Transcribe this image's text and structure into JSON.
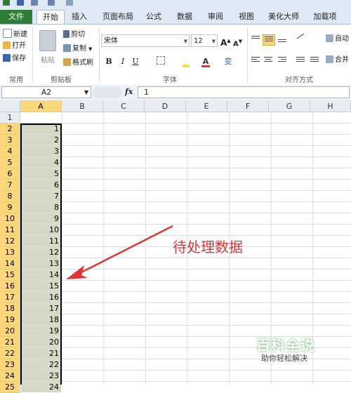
{
  "tabs": [
    {
      "label": "文件"
    },
    {
      "label": "开始"
    },
    {
      "label": "插入"
    },
    {
      "label": "页面布局"
    },
    {
      "label": "公式"
    },
    {
      "label": "数据"
    },
    {
      "label": "审阅"
    },
    {
      "label": "视图"
    },
    {
      "label": "美化大师"
    },
    {
      "label": "加载项"
    }
  ],
  "ribbon": {
    "common": {
      "new": "新建",
      "open": "打开",
      "save": "保存",
      "group": "常用"
    },
    "clipboard": {
      "paste": "粘贴",
      "cut": "剪切",
      "copy": "复制",
      "format_painter": "格式刷",
      "group": "剪贴板"
    },
    "font": {
      "name": "宋体",
      "size": "12",
      "bold": "B",
      "italic": "I",
      "underline": "U",
      "group": "字体",
      "wen": "变"
    },
    "alignment": {
      "group": "对齐方式",
      "wrap": "自动",
      "merge": "合并"
    }
  },
  "formula_bar": {
    "name_box": "A2",
    "fx": "fx",
    "value": "1"
  },
  "columns": [
    "A",
    "B",
    "C",
    "D",
    "E",
    "F",
    "G",
    "H"
  ],
  "rows": [
    "1",
    "2",
    "3",
    "4",
    "5",
    "6",
    "7",
    "8",
    "9",
    "10",
    "11",
    "12",
    "13",
    "14",
    "15",
    "16",
    "17",
    "18",
    "19",
    "20",
    "21",
    "22",
    "23",
    "24",
    "25"
  ],
  "cells_a": [
    "1",
    "2",
    "3",
    "4",
    "5",
    "6",
    "7",
    "8",
    "9",
    "10",
    "11",
    "12",
    "13",
    "14",
    "15",
    "16",
    "17",
    "18",
    "19",
    "20",
    "21",
    "22",
    "23",
    "24"
  ],
  "annotation": "待处理数据",
  "watermark": {
    "title": "百科全说",
    "subtitle": "助你轻松解决"
  },
  "colors": {
    "accent_file": "#2e7e35",
    "selection_header": "#f9d77a",
    "annotation": "#e03434",
    "cell_fill": "#d8d8c8"
  }
}
